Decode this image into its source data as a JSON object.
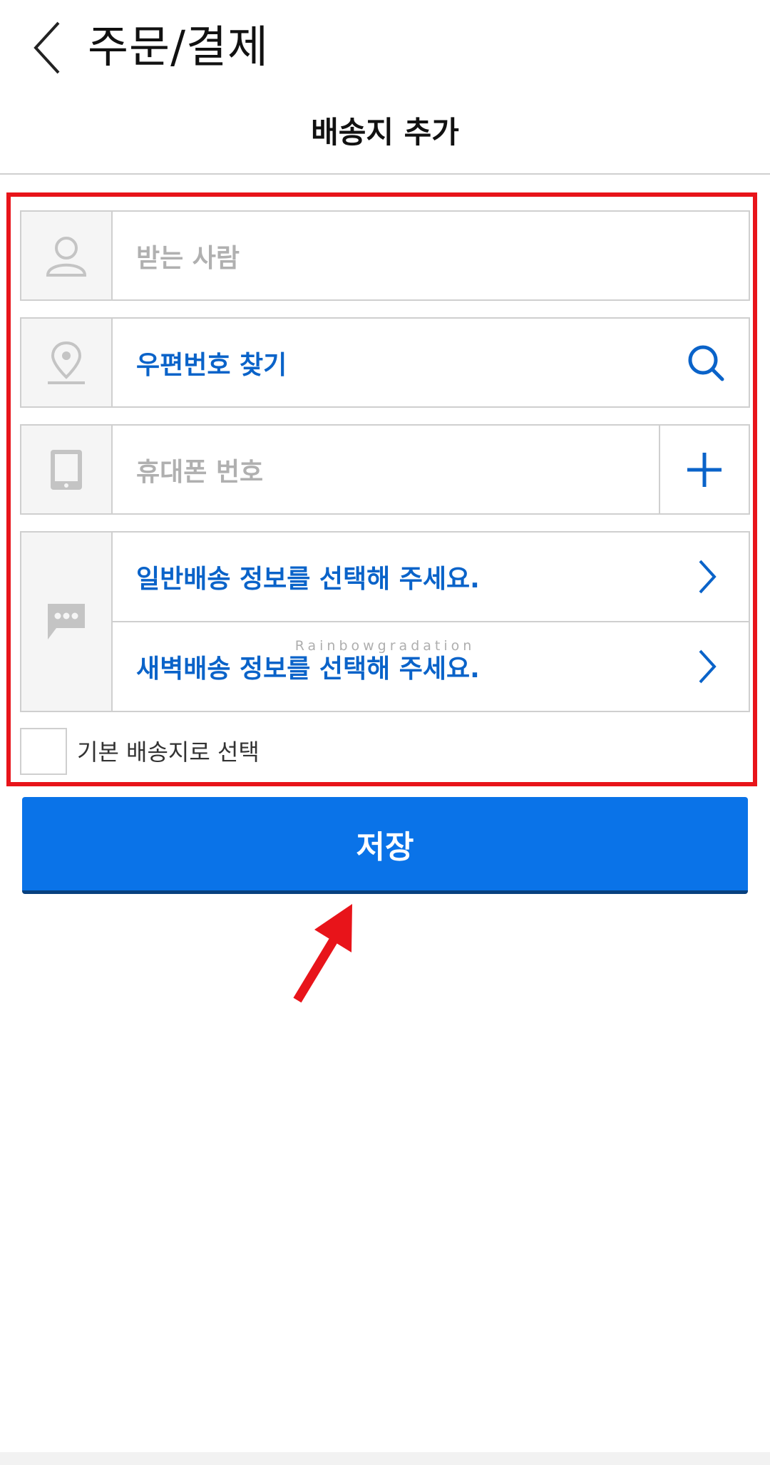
{
  "header": {
    "back_icon": "chevron-left-icon",
    "title": "주문/결제"
  },
  "section": {
    "title": "배송지 추가"
  },
  "form": {
    "recipient": {
      "icon": "person-icon",
      "placeholder": "받는 사람"
    },
    "postal": {
      "icon": "location-pin-icon",
      "label": "우편번호 찾기",
      "action_icon": "search-icon"
    },
    "phone": {
      "icon": "mobile-phone-icon",
      "placeholder": "휴대폰 번호",
      "action_icon": "plus-icon"
    },
    "delivery": {
      "icon": "chat-bubble-icon",
      "general": {
        "label": "일반배송 정보를 선택해 주세요.",
        "action_icon": "chevron-right-icon"
      },
      "dawn": {
        "label": "새벽배송 정보를 선택해 주세요.",
        "action_icon": "chevron-right-icon"
      }
    },
    "default_address": {
      "label": "기본 배송지로 선택",
      "checked": false
    }
  },
  "watermark": {
    "text": "Rainbowgradation"
  },
  "save_button": {
    "label": "저장"
  },
  "colors": {
    "accent": "#0a73e8",
    "link_blue": "#0a63c9",
    "annotation_red": "#e8141a",
    "placeholder": "#b0b0b0"
  }
}
